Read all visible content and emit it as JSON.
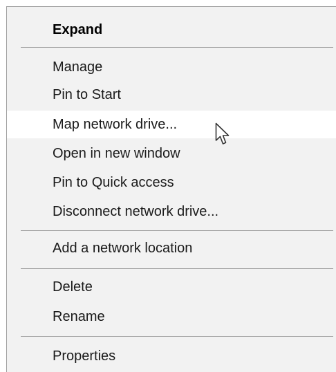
{
  "context_menu": {
    "items": [
      {
        "label": "Expand",
        "bold": true
      },
      {
        "label": "Manage"
      },
      {
        "label": "Pin to Start"
      },
      {
        "label": "Map network drive...",
        "hovered": true
      },
      {
        "label": "Open in new window"
      },
      {
        "label": "Pin to Quick access"
      },
      {
        "label": "Disconnect network drive..."
      },
      {
        "label": "Add a network location"
      },
      {
        "label": "Delete"
      },
      {
        "label": "Rename"
      },
      {
        "label": "Properties"
      }
    ]
  },
  "cursor": {
    "icon": "mouse-pointer-icon"
  },
  "colors": {
    "menu_background": "#f2f2f2",
    "hover_background": "#ffffff",
    "separator": "#a0a0a0",
    "text": "#1a1a1a"
  }
}
